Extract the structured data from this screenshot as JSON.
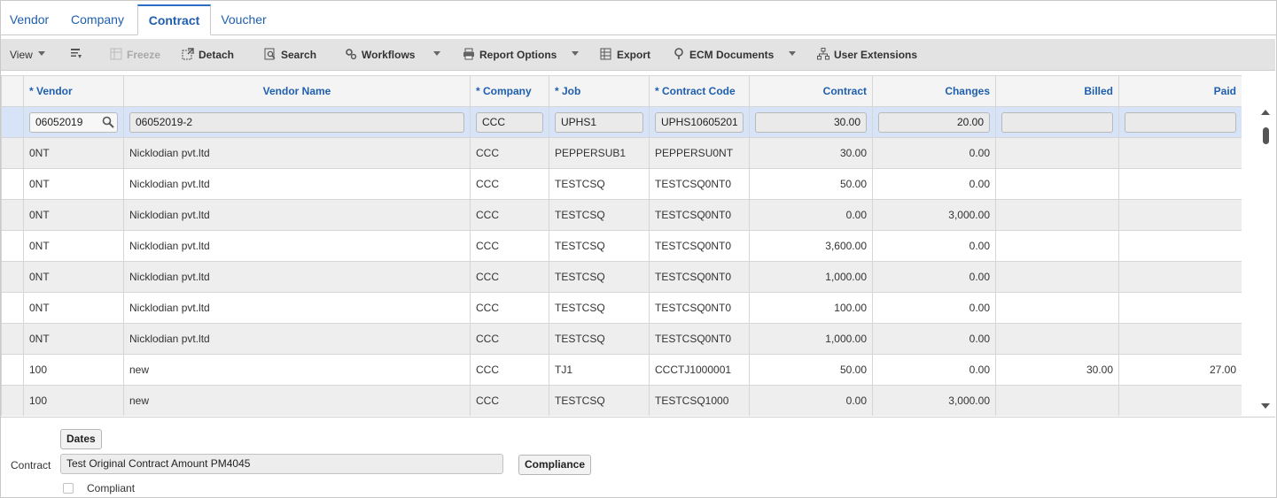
{
  "tabs": [
    {
      "label": "Vendor"
    },
    {
      "label": "Company"
    },
    {
      "label": "Contract",
      "active": true
    },
    {
      "label": "Voucher"
    }
  ],
  "toolbar": {
    "view": "View",
    "freeze": "Freeze",
    "detach": "Detach",
    "search": "Search",
    "workflows": "Workflows",
    "report_options": "Report Options",
    "export": "Export",
    "ecm_documents": "ECM Documents",
    "user_extensions": "User Extensions"
  },
  "grid": {
    "columns": [
      "* Vendor",
      "Vendor Name",
      "* Company",
      "* Job",
      "* Contract Code",
      "Contract",
      "Changes",
      "Billed",
      "Paid"
    ],
    "edit_row": {
      "vendor": "06052019",
      "vendor_name": "06052019-2",
      "company": "CCC",
      "job": "UPHS1",
      "contract_code": "UPHS10605201",
      "contract": "30.00",
      "changes": "20.00",
      "billed": "",
      "paid": ""
    },
    "rows": [
      {
        "vendor": "0NT",
        "vendor_name": "Nicklodian pvt.ltd",
        "company": "CCC",
        "job": "PEPPERSUB1",
        "contract_code": "PEPPERSU0NT",
        "contract": "30.00",
        "changes": "0.00",
        "billed": "",
        "paid": ""
      },
      {
        "vendor": "0NT",
        "vendor_name": "Nicklodian pvt.ltd",
        "company": "CCC",
        "job": "TESTCSQ",
        "contract_code": "TESTCSQ0NT0",
        "contract": "50.00",
        "changes": "0.00",
        "billed": "",
        "paid": ""
      },
      {
        "vendor": "0NT",
        "vendor_name": "Nicklodian pvt.ltd",
        "company": "CCC",
        "job": "TESTCSQ",
        "contract_code": "TESTCSQ0NT0",
        "contract": "0.00",
        "changes": "3,000.00",
        "billed": "",
        "paid": ""
      },
      {
        "vendor": "0NT",
        "vendor_name": "Nicklodian pvt.ltd",
        "company": "CCC",
        "job": "TESTCSQ",
        "contract_code": "TESTCSQ0NT0",
        "contract": "3,600.00",
        "changes": "0.00",
        "billed": "",
        "paid": ""
      },
      {
        "vendor": "0NT",
        "vendor_name": "Nicklodian pvt.ltd",
        "company": "CCC",
        "job": "TESTCSQ",
        "contract_code": "TESTCSQ0NT0",
        "contract": "1,000.00",
        "changes": "0.00",
        "billed": "",
        "paid": ""
      },
      {
        "vendor": "0NT",
        "vendor_name": "Nicklodian pvt.ltd",
        "company": "CCC",
        "job": "TESTCSQ",
        "contract_code": "TESTCSQ0NT0",
        "contract": "100.00",
        "changes": "0.00",
        "billed": "",
        "paid": ""
      },
      {
        "vendor": "0NT",
        "vendor_name": "Nicklodian pvt.ltd",
        "company": "CCC",
        "job": "TESTCSQ",
        "contract_code": "TESTCSQ0NT0",
        "contract": "1,000.00",
        "changes": "0.00",
        "billed": "",
        "paid": ""
      },
      {
        "vendor": "100",
        "vendor_name": "new",
        "company": "CCC",
        "job": "TJ1",
        "contract_code": "CCCTJ1000001",
        "contract": "50.00",
        "changes": "0.00",
        "billed": "30.00",
        "paid": "27.00"
      },
      {
        "vendor": "100",
        "vendor_name": "new",
        "company": "CCC",
        "job": "TESTCSQ",
        "contract_code": "TESTCSQ1000",
        "contract": "0.00",
        "changes": "3,000.00",
        "billed": "",
        "paid": ""
      }
    ]
  },
  "bottom": {
    "dates_button": "Dates",
    "contract_label": "Contract",
    "contract_description": "Test Original Contract Amount PM4045",
    "compliance_button": "Compliance",
    "compliant_label": "Compliant"
  }
}
